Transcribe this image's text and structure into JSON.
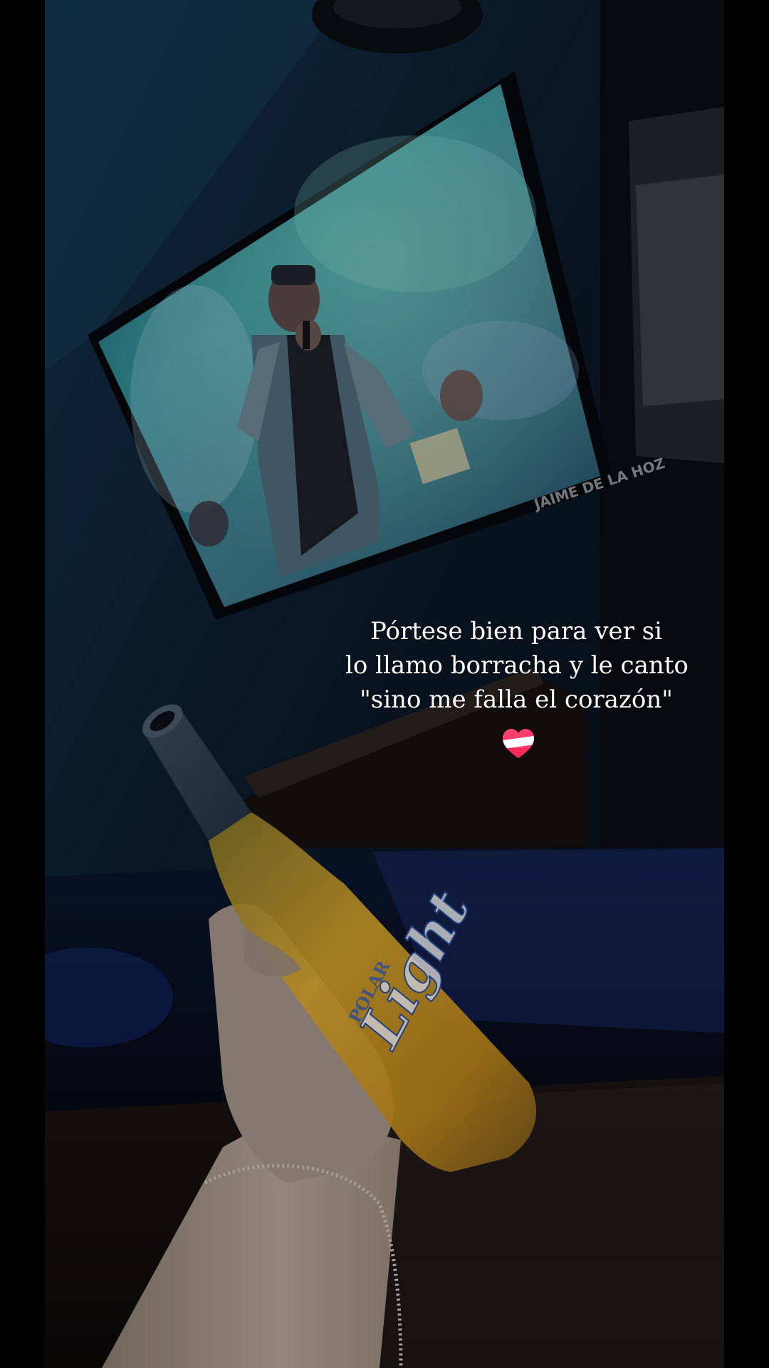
{
  "caption": {
    "lines": [
      "Pórtese bien para ver si",
      "lo llamo borracha y le canto",
      "\"sino me falla el corazón\""
    ],
    "emoji": "heart-emoji"
  },
  "tv_watermark": "JAIME DE LA HOZ",
  "bottle_label": {
    "brand_small": "POLAR",
    "brand_main": "Light"
  },
  "colors": {
    "background": "#000000",
    "caption_text": "#ffffff",
    "heart_top": "#ff3d6e",
    "heart_band": "#ffffff"
  }
}
